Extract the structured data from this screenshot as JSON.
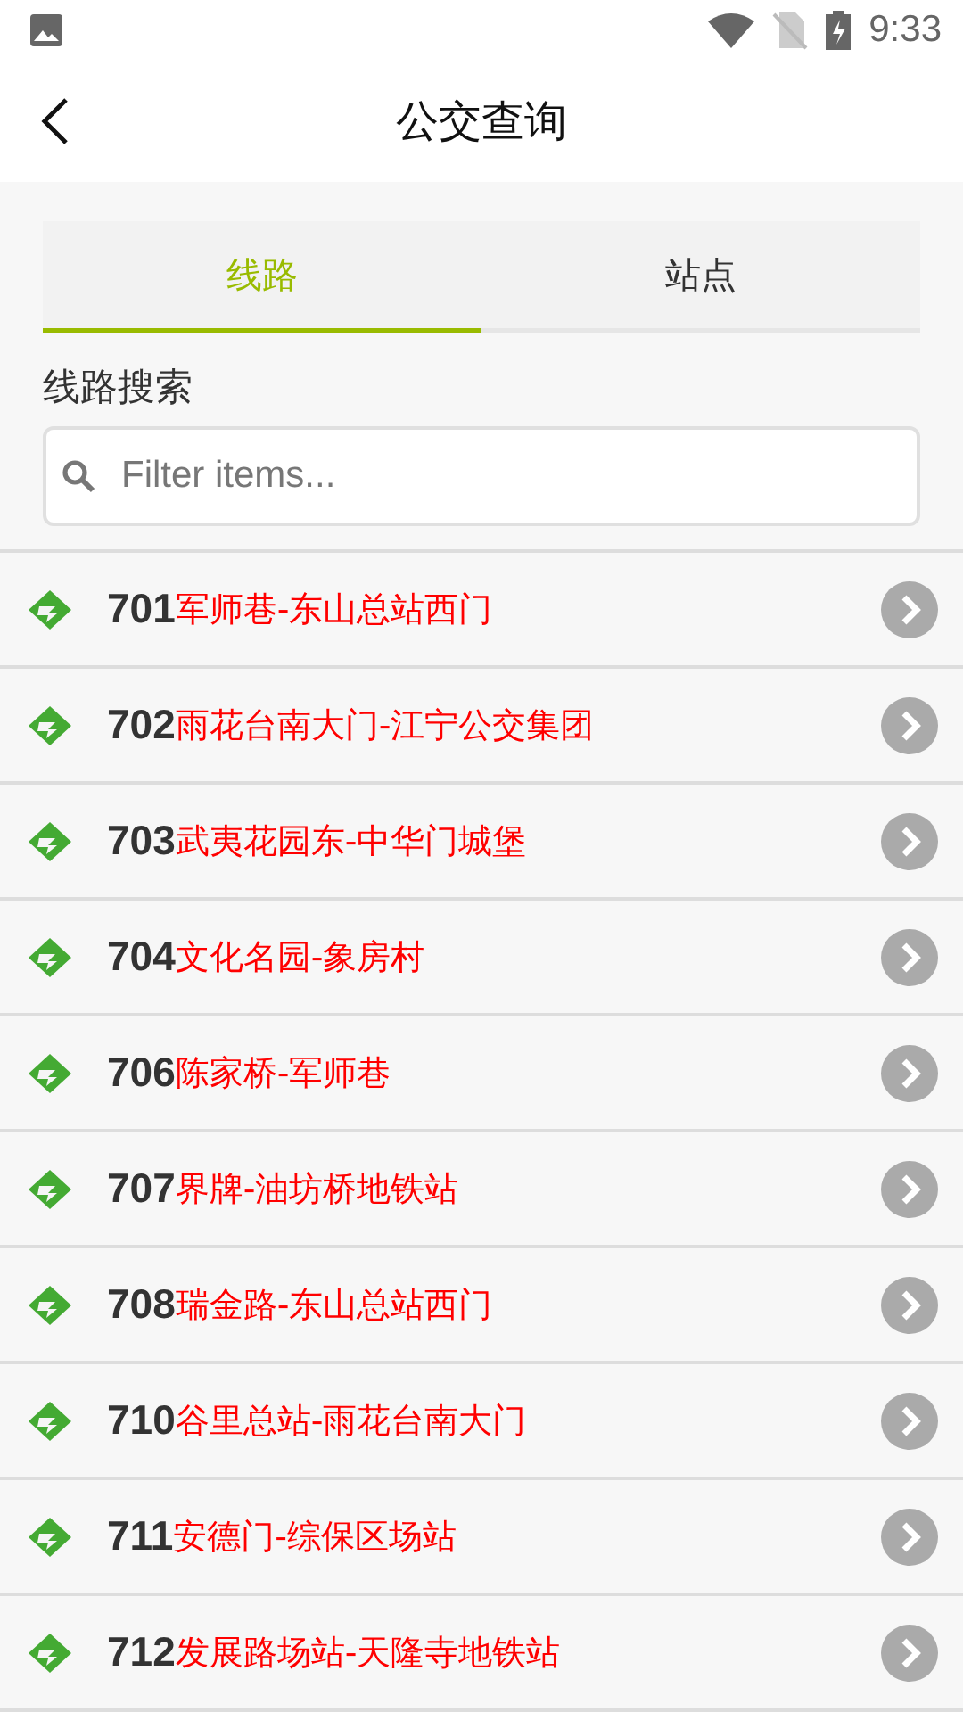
{
  "status_bar": {
    "time": "9:33"
  },
  "header": {
    "title": "公交查询"
  },
  "tabs": [
    {
      "label": "线路",
      "selected": true
    },
    {
      "label": "站点",
      "selected": false
    }
  ],
  "search": {
    "label": "线路搜索",
    "placeholder": "Filter items..."
  },
  "routes": [
    {
      "number": "701",
      "name": "军师巷-东山总站西门"
    },
    {
      "number": "702",
      "name": "雨花台南大门-江宁公交集团"
    },
    {
      "number": "703",
      "name": "武夷花园东-中华门城堡"
    },
    {
      "number": "704",
      "name": "文化名园-象房村"
    },
    {
      "number": "706",
      "name": "陈家桥-军师巷"
    },
    {
      "number": "707",
      "name": "界牌-油坊桥地铁站"
    },
    {
      "number": "708",
      "name": "瑞金路-东山总站西门"
    },
    {
      "number": "710",
      "name": "谷里总站-雨花台南大门"
    },
    {
      "number": "711",
      "name": "安德门-综保区场站"
    },
    {
      "number": "712",
      "name": "发展路场站-天隆寺地铁站"
    }
  ]
}
